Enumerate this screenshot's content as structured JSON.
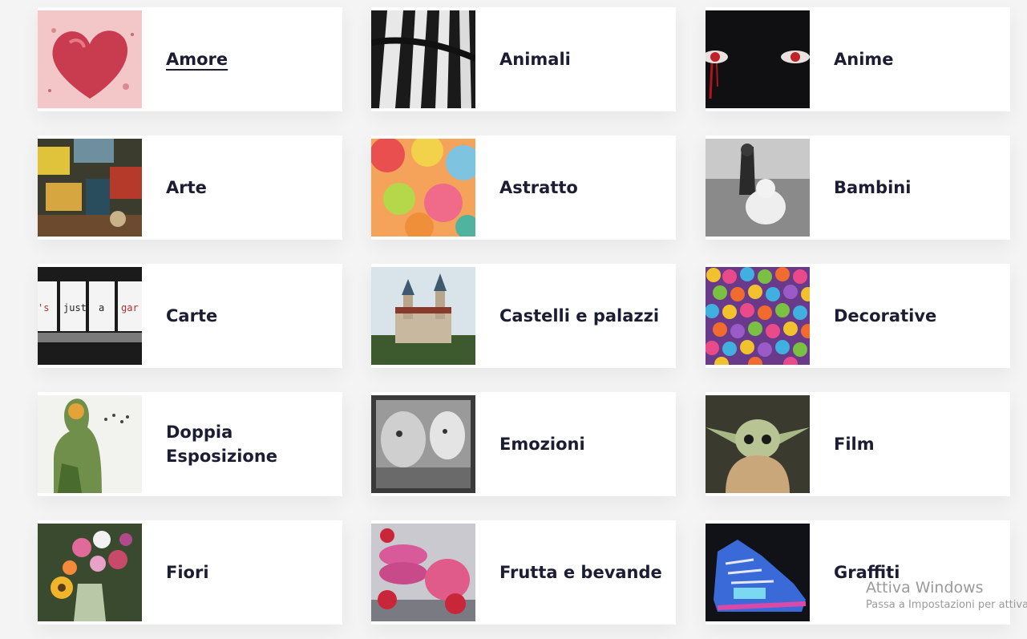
{
  "categories": [
    {
      "label": "Amore"
    },
    {
      "label": "Animali"
    },
    {
      "label": "Anime"
    },
    {
      "label": "Arte"
    },
    {
      "label": "Astratto"
    },
    {
      "label": "Bambini"
    },
    {
      "label": "Carte"
    },
    {
      "label": "Castelli e palazzi"
    },
    {
      "label": "Decorative"
    },
    {
      "label": "Doppia Esposizione"
    },
    {
      "label": "Emozioni"
    },
    {
      "label": "Film"
    },
    {
      "label": "Fiori"
    },
    {
      "label": "Frutta e bevande"
    },
    {
      "label": "Graffiti"
    }
  ],
  "thumb_text": {
    "cards": [
      "'s",
      "just",
      "a",
      "gar"
    ]
  },
  "watermark": {
    "title": "Attiva Windows",
    "subtitle": "Passa a Impostazioni per attivare Windows."
  },
  "colors": {
    "text": "#1c1d33",
    "background": "#f4f4f4",
    "card": "#ffffff"
  }
}
